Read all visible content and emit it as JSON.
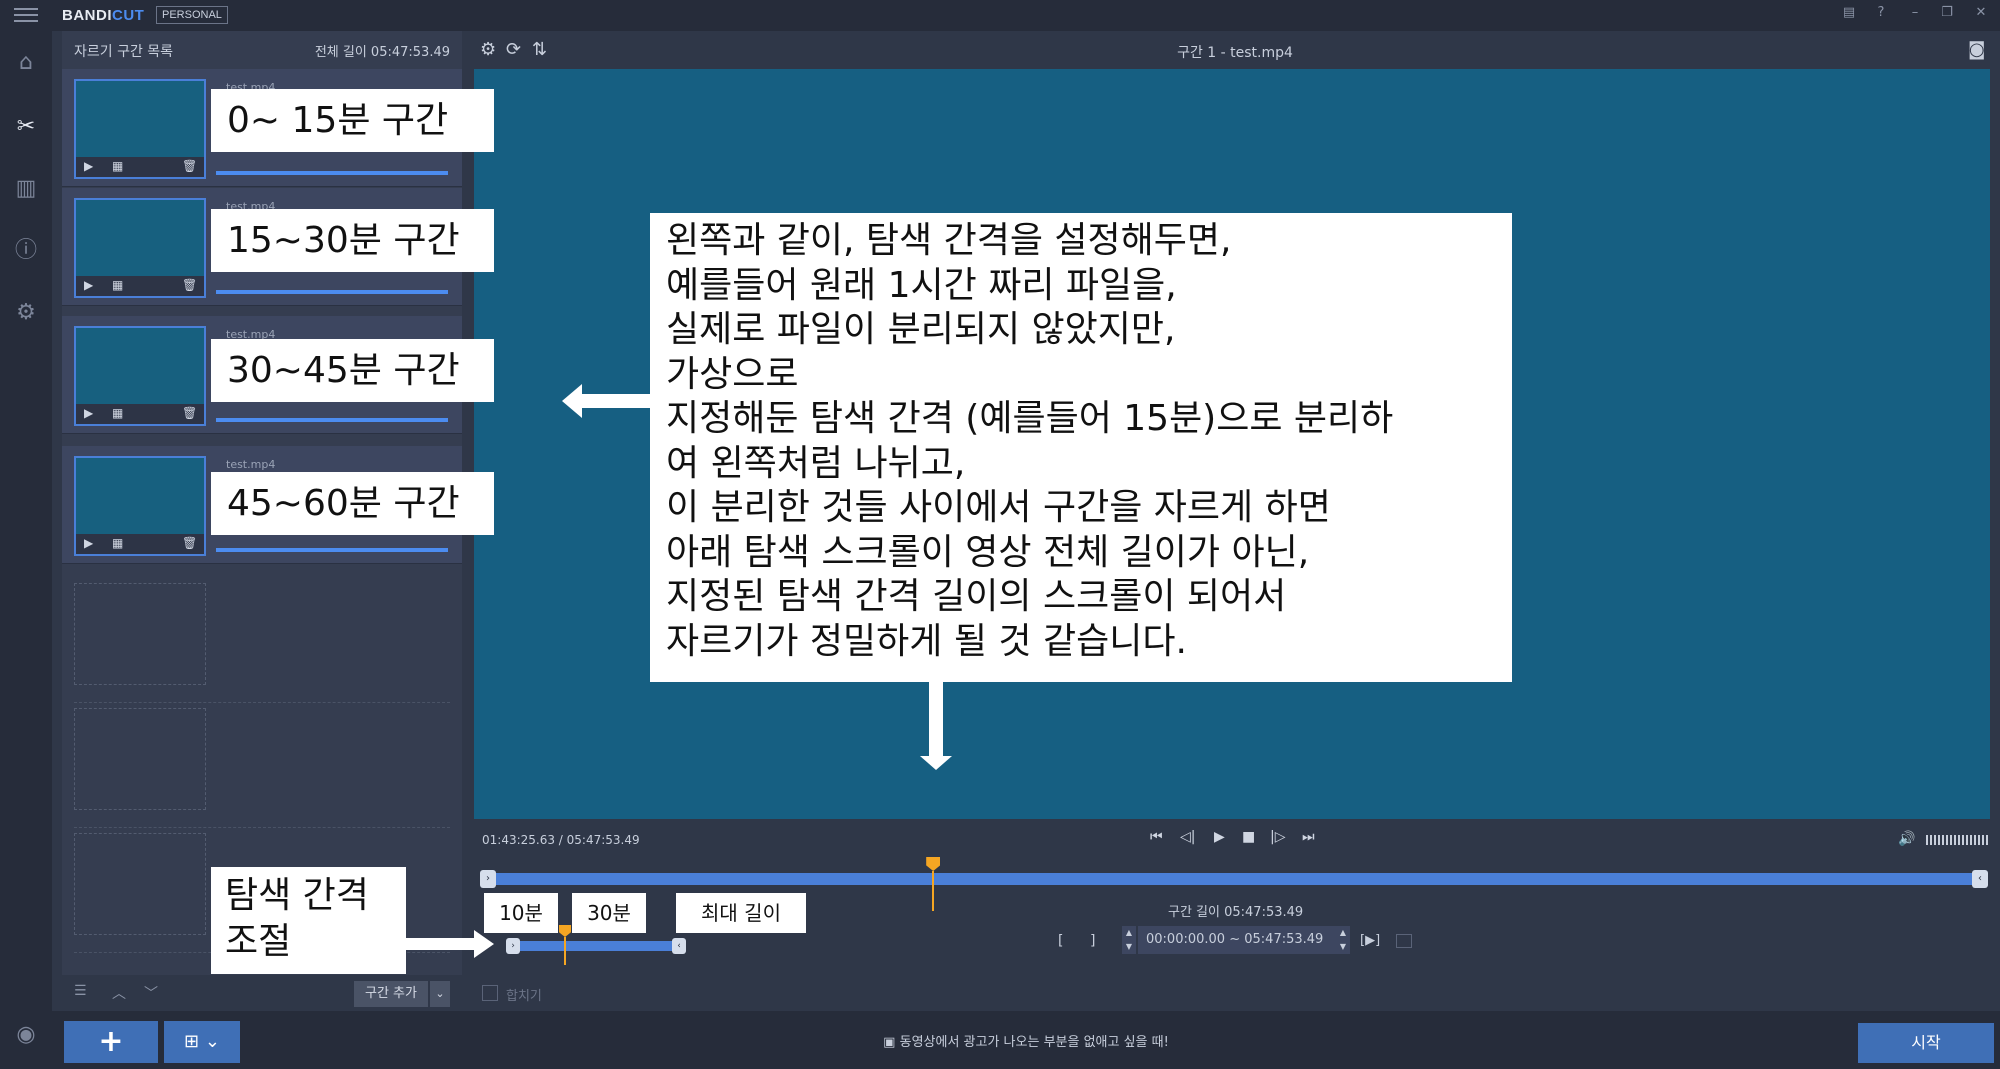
{
  "app": {
    "brand_main": "BANDI",
    "brand_accent": "CUT",
    "edition": "PERSONAL"
  },
  "window_controls": [
    "folder-icon",
    "help-icon",
    "minimize-icon",
    "restore-icon",
    "close-icon"
  ],
  "list": {
    "title": "자르기 구간 목록",
    "total_length": "전체 길이 05:47:53.49",
    "clips": [
      {
        "name": "test.mp4",
        "label": "0~ 15분 구간"
      },
      {
        "name": "test.mp4",
        "label": "15~30분 구간"
      },
      {
        "name": "test.mp4",
        "label": "30~45분 구간"
      },
      {
        "name": "test.mp4",
        "label": "45~60분 구간"
      }
    ],
    "add_section_label": "구간 추가"
  },
  "video": {
    "title": "구간 1 - test.mp4",
    "time_readout": "01:43:25.63 / 05:47:53.49",
    "section_length": "구간 길이 05:47:53.49",
    "range_start": "00:00:00.00",
    "range_separator": "~",
    "range_end": "05:47:53.49",
    "play_section_label": "[▶]",
    "merge_label": "합치기",
    "main_playhead_fraction": 0.3
  },
  "bottom": {
    "add_label": "+",
    "ad_tip": "동영상에서 광고가 나오는 부분을 없애고 싶을 때!",
    "start_label": "시작"
  },
  "annotations": {
    "note_lines": [
      "왼쪽과 같이, 탐색 간격을 설정해두면,",
      "예를들어 원래 1시간 짜리 파일을,",
      "실제로 파일이 분리되지 않았지만,",
      "가상으로",
      "지정해둔 탐색 간격 (예를들어 15분)으로 분리하",
      "여 왼쪽처럼 나뉘고,",
      "이 분리한 것들 사이에서 구간을 자르게 하면",
      "아래 탐색 스크롤이 영상 전체 길이가 아닌,",
      "지정된 탐색 간격 길이의 스크롤이 되어서",
      "자르기가 정밀하게 될 것 같습니다."
    ],
    "interval_label_line1": "탐색 간격",
    "interval_label_line2": "조절",
    "tick_10": "10분",
    "tick_30": "30분",
    "tick_max": "최대 길이"
  },
  "colors": {
    "accent": "#4c8cf0",
    "playhead": "#f5a623",
    "video_bg": "#165f82"
  }
}
